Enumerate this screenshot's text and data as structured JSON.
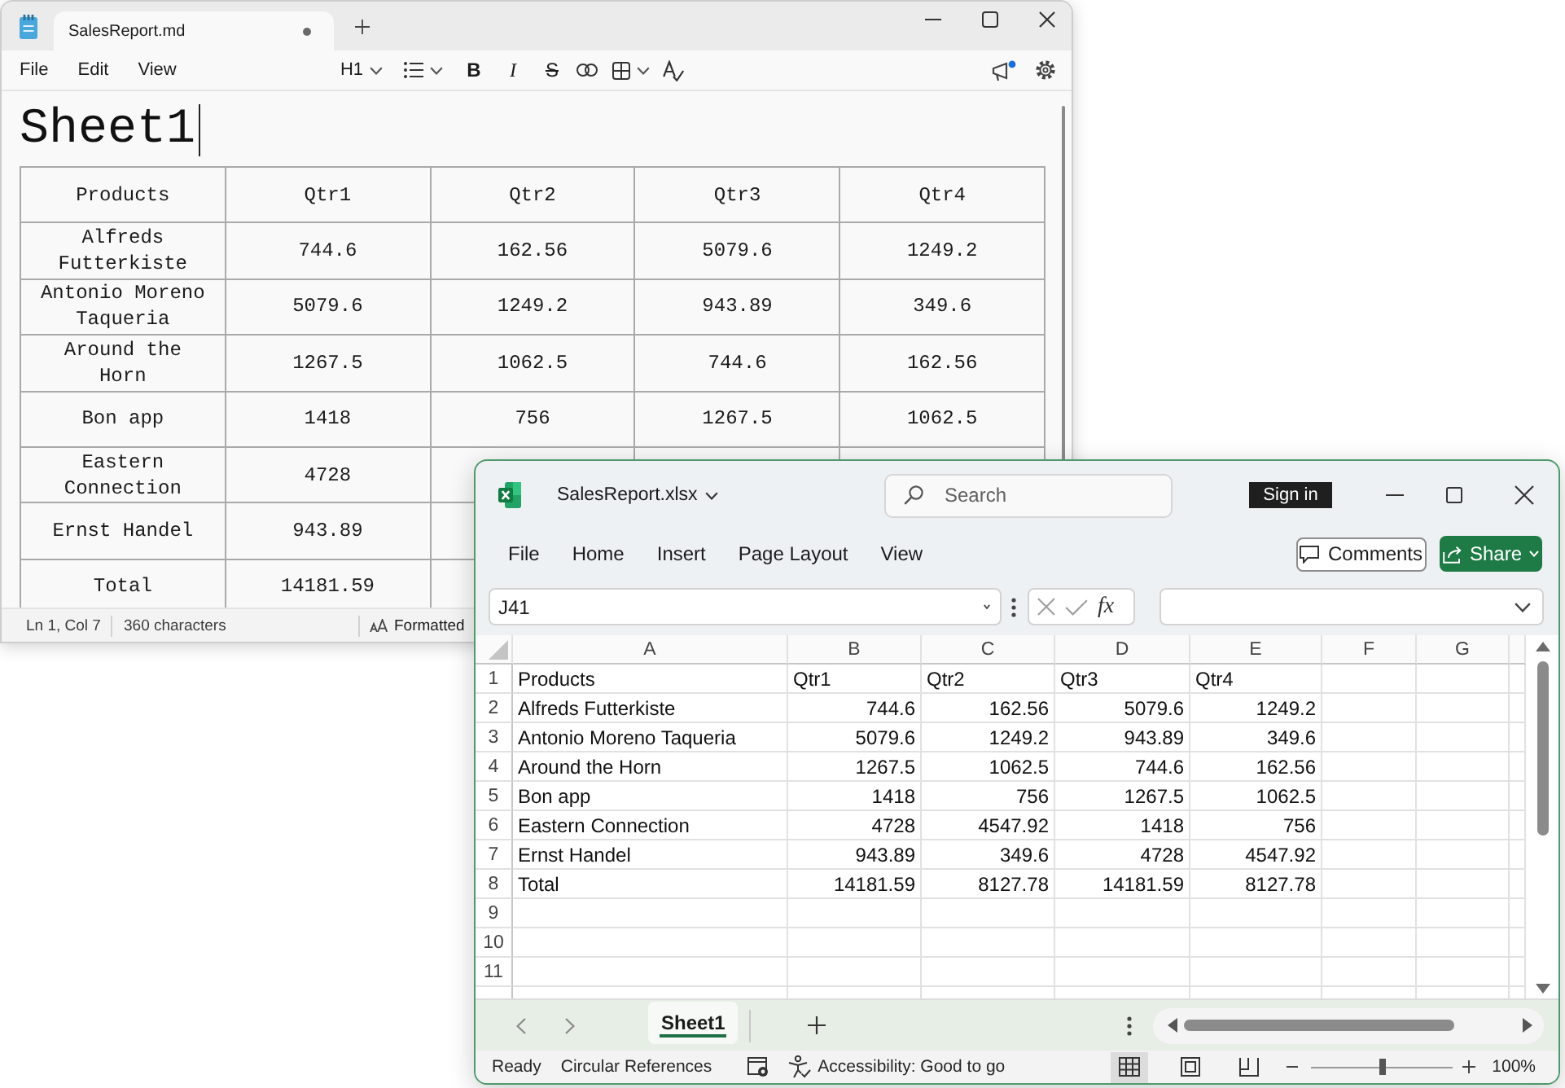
{
  "notepad": {
    "tabs": [
      {
        "title": "SalesReport.md",
        "selected": true,
        "unsaved": true
      }
    ],
    "menu": [
      "File",
      "Edit",
      "View"
    ],
    "toolbar": {
      "heading": "H1",
      "bold": "B",
      "italic": "I",
      "strikethrough": "S"
    },
    "document": {
      "heading": "Sheet1",
      "table": {
        "columns": [
          "Products",
          "Qtr1",
          "Qtr2",
          "Qtr3",
          "Qtr4"
        ],
        "rows": [
          [
            "Alfreds Futterkiste",
            "744.6",
            "162.56",
            "5079.6",
            "1249.2"
          ],
          [
            "Antonio Moreno Taqueria",
            "5079.6",
            "1249.2",
            "943.89",
            "349.6"
          ],
          [
            "Around the Horn",
            "1267.5",
            "1062.5",
            "744.6",
            "162.56"
          ],
          [
            "Bon app",
            "1418",
            "756",
            "1267.5",
            "1062.5"
          ],
          [
            "Eastern Connection",
            "4728"
          ],
          [
            "Ernst Handel",
            "943.89"
          ],
          [
            "Total",
            "14181.59"
          ]
        ]
      }
    },
    "status_bar": {
      "position": "Ln 1, Col 7",
      "characters": "360 characters",
      "mode": "Formatted"
    }
  },
  "excel": {
    "file_name": "SalesReport.xlsx",
    "search": {
      "placeholder": "Search"
    },
    "sign_in": "Sign in",
    "ribbon_tabs": [
      "File",
      "Home",
      "Insert",
      "Page Layout",
      "View"
    ],
    "comments": "Comments",
    "share": "Share",
    "name_box": "J41",
    "function_label": "fx",
    "grid": {
      "columns": [
        "A",
        "B",
        "C",
        "D",
        "E",
        "F",
        "G"
      ],
      "rows": [
        {
          "number": "1",
          "kind": "header",
          "cells": [
            "Products",
            "Qtr1",
            "Qtr2",
            "Qtr3",
            "Qtr4"
          ]
        },
        {
          "number": "2",
          "kind": "data",
          "cells": [
            "Alfreds Futterkiste",
            "744.6",
            "162.56",
            "5079.6",
            "1249.2"
          ]
        },
        {
          "number": "3",
          "kind": "data",
          "cells": [
            "Antonio Moreno Taqueria",
            "5079.6",
            "1249.2",
            "943.89",
            "349.6"
          ]
        },
        {
          "number": "4",
          "kind": "data",
          "cells": [
            "Around the Horn",
            "1267.5",
            "1062.5",
            "744.6",
            "162.56"
          ]
        },
        {
          "number": "5",
          "kind": "data",
          "cells": [
            "Bon app",
            "1418",
            "756",
            "1267.5",
            "1062.5"
          ]
        },
        {
          "number": "6",
          "kind": "data",
          "cells": [
            "Eastern Connection",
            "4728",
            "4547.92",
            "1418",
            "756"
          ]
        },
        {
          "number": "7",
          "kind": "data",
          "cells": [
            "Ernst Handel",
            "943.89",
            "349.6",
            "4728",
            "4547.92"
          ]
        },
        {
          "number": "8",
          "kind": "data",
          "cells": [
            "Total",
            "14181.59",
            "8127.78",
            "14181.59",
            "8127.78"
          ]
        },
        {
          "number": "9"
        },
        {
          "number": "10"
        },
        {
          "number": "11"
        }
      ]
    },
    "sheet_tabs": [
      {
        "label": "Sheet1",
        "selected": true
      }
    ],
    "status_bar": {
      "state": "Ready",
      "circular_references": "Circular References",
      "accessibility": "Accessibility: Good to go",
      "views": [
        {
          "kind": "normal",
          "selected": true
        },
        {
          "kind": "page_layout",
          "selected": false
        },
        {
          "kind": "page_break",
          "selected": false
        }
      ],
      "zoom": {
        "level": 0.5,
        "reading": "100%"
      }
    }
  }
}
